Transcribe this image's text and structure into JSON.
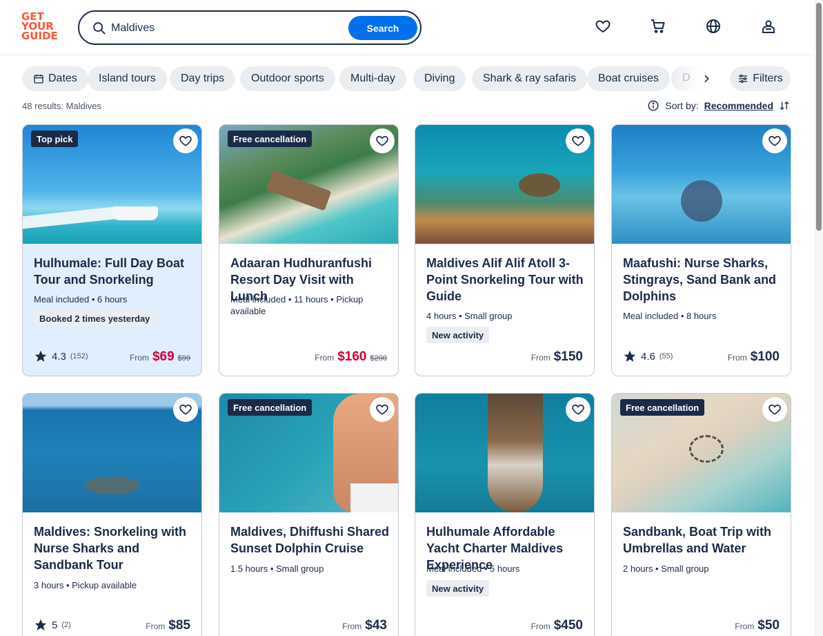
{
  "logo": {
    "line1": "GET",
    "line2": "YOUR",
    "line3": "GUIDE"
  },
  "search": {
    "value": "Maldives",
    "button": "Search"
  },
  "header_icons": [
    "heart-icon",
    "cart-icon",
    "globe-icon",
    "account-icon"
  ],
  "chips": [
    "Dates",
    "Island tours",
    "Day trips",
    "Outdoor sports",
    "Multi-day",
    "Diving",
    "Shark & ray safaris",
    "Boat cruises",
    "D"
  ],
  "filters_label": "Filters",
  "results_text": "48 results: Maldives",
  "sort": {
    "label": "Sort by:",
    "value": "Recommended"
  },
  "colors": {
    "brand": "#ff5533",
    "accent": "#0071eb",
    "sale": "#d10038",
    "text": "#1a2b49"
  },
  "cards": [
    {
      "badge": "Top pick",
      "title": "Hulhumale: Full Day Boat Tour and Snorkeling",
      "meta": "Meal included • 6 hours",
      "tag": "Booked 2 times yesterday",
      "rating": "4.3",
      "rating_count": "(152)",
      "from": "From",
      "price": "$69",
      "old_price": "$99"
    },
    {
      "badge": "Free cancellation",
      "title": "Adaaran Hudhuranfushi Resort Day Visit with Lunch",
      "meta": "Meal included • 11 hours • Pickup available",
      "tag": "",
      "rating": "",
      "rating_count": "",
      "from": "From",
      "price": "$160",
      "old_price": "$200"
    },
    {
      "badge": "",
      "title": "Maldives Alif Alif Atoll 3-Point Snorkeling Tour with Guide",
      "meta": "4 hours • Small group",
      "tag": "New activity",
      "rating": "",
      "rating_count": "",
      "from": "From",
      "price": "$150",
      "old_price": ""
    },
    {
      "badge": "",
      "title": "Maafushi: Nurse Sharks, Stingrays, Sand Bank and Dolphins",
      "meta": "Meal included • 8 hours",
      "tag": "",
      "rating": "4.6",
      "rating_count": "(55)",
      "from": "From",
      "price": "$100",
      "old_price": ""
    },
    {
      "badge": "",
      "title": "Maldives: Snorkeling with Nurse Sharks and Sandbank Tour",
      "meta": "3 hours • Pickup available",
      "tag": "",
      "rating": "5",
      "rating_count": "(2)",
      "from": "From",
      "price": "$85",
      "old_price": ""
    },
    {
      "badge": "Free cancellation",
      "title": "Maldives, Dhiffushi Shared Sunset Dolphin Cruise",
      "meta": "1.5 hours • Small group",
      "tag": "",
      "rating": "",
      "rating_count": "",
      "from": "From",
      "price": "$43",
      "old_price": ""
    },
    {
      "badge": "",
      "title": "Hulhumale Affordable Yacht Charter Maldives Experience",
      "meta": "Meal included • 5 hours",
      "tag": "New activity",
      "rating": "",
      "rating_count": "",
      "from": "From",
      "price": "$450",
      "old_price": ""
    },
    {
      "badge": "Free cancellation",
      "title": "Sandbank, Boat Trip with Umbrellas and Water",
      "meta": "2 hours • Small group",
      "tag": "",
      "rating": "",
      "rating_count": "",
      "from": "From",
      "price": "$50",
      "old_price": ""
    }
  ]
}
